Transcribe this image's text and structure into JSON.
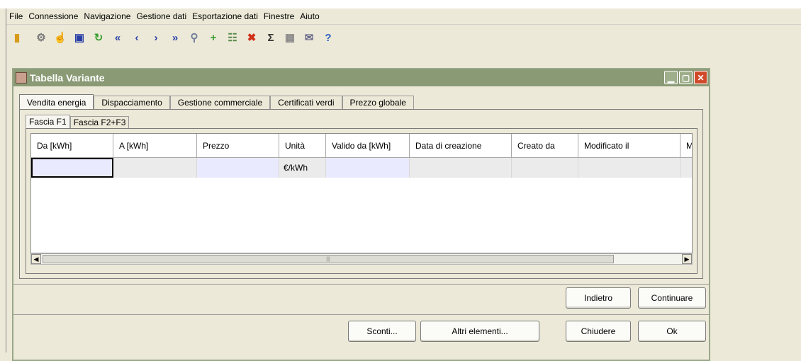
{
  "menu": [
    "File",
    "Connessione",
    "Navigazione",
    "Gestione dati",
    "Esportazione dati",
    "Finestre",
    "Aiuto"
  ],
  "toolbar_icons": [
    {
      "name": "exit-icon",
      "glyph": "▮",
      "color": "#d89a1a"
    },
    {
      "name": "separator",
      "glyph": "",
      "color": ""
    },
    {
      "name": "connect-icon",
      "glyph": "⚙",
      "color": "#7a7a7a"
    },
    {
      "name": "disconnect-icon",
      "glyph": "☝",
      "color": "#e0a020"
    },
    {
      "name": "save-icon",
      "glyph": "▣",
      "color": "#2a3fa6"
    },
    {
      "name": "refresh-icon",
      "glyph": "↻",
      "color": "#3aa030"
    },
    {
      "name": "first-icon",
      "glyph": "«",
      "color": "#2a3fa6"
    },
    {
      "name": "previous-icon",
      "glyph": "‹",
      "color": "#2a3fa6"
    },
    {
      "name": "next-icon",
      "glyph": "›",
      "color": "#2a3fa6"
    },
    {
      "name": "last-icon",
      "glyph": "»",
      "color": "#2a3fa6"
    },
    {
      "name": "search-icon",
      "glyph": "⚲",
      "color": "#6f7d9a"
    },
    {
      "name": "add-icon",
      "glyph": "+",
      "color": "#3aa030"
    },
    {
      "name": "hierarchy-icon",
      "glyph": "☷",
      "color": "#5a8a4a"
    },
    {
      "name": "delete-icon",
      "glyph": "✖",
      "color": "#d0301a"
    },
    {
      "name": "sum-icon",
      "glyph": "Σ",
      "color": "#333333"
    },
    {
      "name": "calendar-icon",
      "glyph": "▦",
      "color": "#8a8a8a"
    },
    {
      "name": "email-icon",
      "glyph": "✉",
      "color": "#6a6a8a"
    },
    {
      "name": "help-icon",
      "glyph": "?",
      "color": "#2a5fc0"
    }
  ],
  "window": {
    "title": "Tabella Variante"
  },
  "tabs": [
    "Vendita energia",
    "Dispacciamento",
    "Gestione commerciale",
    "Certificati verdi",
    "Prezzo globale"
  ],
  "subtabs": [
    "Fascia F1",
    "Fascia F2+F3"
  ],
  "table": {
    "columns": [
      "Da [kWh]",
      "A [kWh]",
      "Prezzo",
      "Unità",
      "Valido da [kWh]",
      "Data di creazione",
      "Creato da",
      "Modificato il",
      "M"
    ],
    "row": [
      "",
      "",
      "",
      "€/kWh",
      "",
      "",
      "",
      "",
      ""
    ]
  },
  "buttons": {
    "back": "Indietro",
    "continue": "Continuare",
    "discounts": "Sconti...",
    "other_items": "Altri elementi...",
    "close": "Chiudere",
    "ok": "Ok"
  }
}
